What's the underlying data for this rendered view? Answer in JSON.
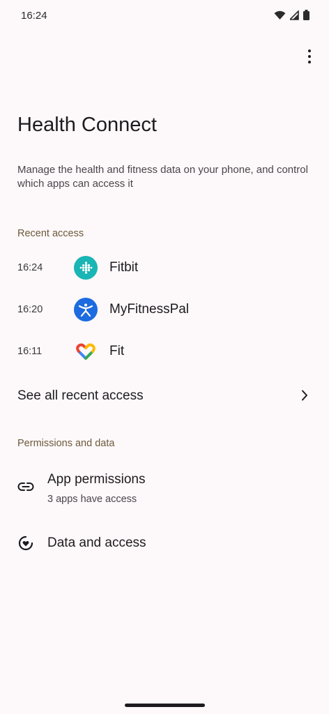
{
  "status_bar": {
    "time": "16:24",
    "icons": [
      "wifi-icon",
      "cell-signal-icon",
      "battery-icon"
    ]
  },
  "header": {
    "overflow_icon": "more-vert-icon",
    "title": "Health Connect",
    "description": "Manage the health and fitness data on your phone, and control which apps can access it"
  },
  "recent_access": {
    "section_label": "Recent access",
    "items": [
      {
        "time": "16:24",
        "app": "Fitbit",
        "icon": "fitbit-icon",
        "icon_color": "#1ab5b5"
      },
      {
        "time": "16:20",
        "app": "MyFitnessPal",
        "icon": "myfitnesspal-icon",
        "icon_color": "#1d6be0"
      },
      {
        "time": "16:11",
        "app": "Fit",
        "icon": "google-fit-icon",
        "icon_color": "#ea4335"
      }
    ],
    "see_all_label": "See all recent access"
  },
  "permissions": {
    "section_label": "Permissions and data",
    "app_permissions": {
      "title": "App permissions",
      "subtitle": "3 apps have access",
      "icon": "link-icon"
    },
    "data_and_access": {
      "title": "Data and access",
      "icon": "heart-circle-icon"
    }
  },
  "colors": {
    "background": "#fdf8fa",
    "section_label": "#6c5a3b",
    "text_primary": "#1d1b1e"
  }
}
